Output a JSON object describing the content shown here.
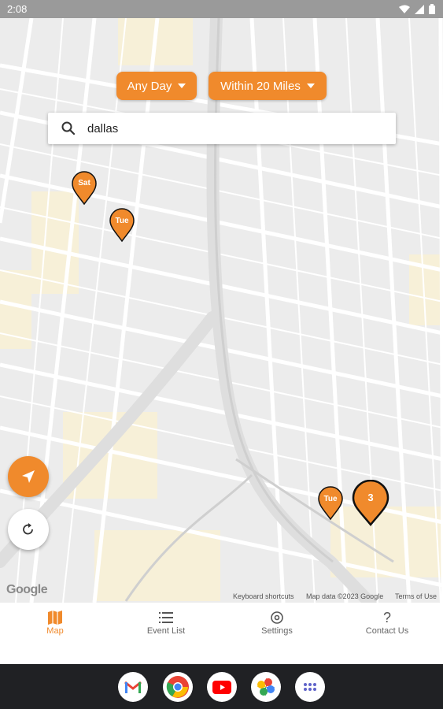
{
  "status_bar": {
    "time": "2:08"
  },
  "filters": {
    "day_label": "Any Day",
    "distance_label": "Within 20 Miles"
  },
  "search": {
    "value": "dallas"
  },
  "markers": [
    {
      "label": "Sat"
    },
    {
      "label": "Tue"
    },
    {
      "label": "Tue"
    },
    {
      "label": "3"
    }
  ],
  "map_attribution": {
    "logo": "Google",
    "keyboard_shortcuts": "Keyboard shortcuts",
    "map_data": "Map data ©2023 Google",
    "terms": "Terms of Use"
  },
  "bottom_nav": [
    {
      "label": "Map",
      "icon": "map-icon",
      "active": true
    },
    {
      "label": "Event List",
      "icon": "list-icon",
      "active": false
    },
    {
      "label": "Settings",
      "icon": "settings-icon",
      "active": false
    },
    {
      "label": "Contact Us",
      "icon": "question-icon",
      "active": false
    }
  ],
  "dock_apps": [
    "gmail-icon",
    "chrome-icon",
    "youtube-icon",
    "photos-icon",
    "app-drawer-icon"
  ],
  "colors": {
    "accent": "#f08a2c",
    "dock": "#202124",
    "status_bar": "#9a9a9a"
  }
}
